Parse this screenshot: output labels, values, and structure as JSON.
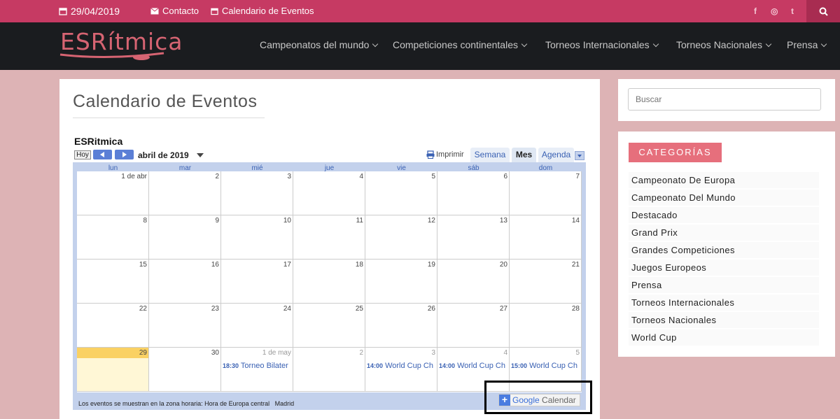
{
  "topbar": {
    "date": "29/04/2019",
    "contact": "Contacto",
    "calendar_link": "Calendario de Eventos",
    "social": [
      "f",
      "◎",
      "t"
    ]
  },
  "logo": {
    "text": "ESRítmica"
  },
  "nav": [
    "Campeonatos del mundo",
    "Competiciones continentales",
    "Torneos Internacionales",
    "Torneos Nacionales",
    "Prensa"
  ],
  "page": {
    "title": "Calendario de Eventos"
  },
  "calendar": {
    "name": "ESRitmica",
    "today_label": "Hoy",
    "month_label": "abril de 2019",
    "print_label": "Imprimir",
    "views": [
      "Semana",
      "Mes",
      "Agenda"
    ],
    "day_headers": [
      "lun",
      "mar",
      "mié",
      "jue",
      "vie",
      "sáb",
      "dom"
    ],
    "weeks": [
      [
        "1 de abr",
        "2",
        "3",
        "4",
        "5",
        "6",
        "7"
      ],
      [
        "8",
        "9",
        "10",
        "11",
        "12",
        "13",
        "14"
      ],
      [
        "15",
        "16",
        "17",
        "18",
        "19",
        "20",
        "21"
      ],
      [
        "22",
        "23",
        "24",
        "25",
        "26",
        "27",
        "28"
      ],
      [
        "29",
        "30",
        "1 de may",
        "2",
        "3",
        "4",
        "5"
      ]
    ],
    "events": [
      {
        "time": "18:30",
        "title": "Torneo Bilater"
      },
      {
        "time": "14:00",
        "title": "World Cup Ch"
      },
      {
        "time": "14:00",
        "title": "World Cup Ch"
      },
      {
        "time": "15:00",
        "title": "World Cup Ch"
      }
    ],
    "timezone_note": "Los eventos se muestran en la zona horaria: Hora de Europa central   Madrid",
    "gcal": {
      "plus": "+",
      "google": "Google",
      "calendar": "Calendar"
    }
  },
  "sidebar": {
    "search_placeholder": "Buscar",
    "categories_title": "CATEGORÍAS",
    "categories": [
      "Campeonato De Europa",
      "Campeonato Del Mundo",
      "Destacado",
      "Grand Prix",
      "Grandes Competiciones",
      "Juegos Europeos",
      "Prensa",
      "Torneos Internacionales",
      "Torneos Nacionales",
      "World Cup"
    ]
  },
  "colors": {
    "topbar": "#c63a63",
    "nav": "#1a1c1f",
    "page_bg": "#ddb3b5",
    "accent": "#e66f7c",
    "calendar_blue": "#3a61b3",
    "today": "#fad163"
  }
}
